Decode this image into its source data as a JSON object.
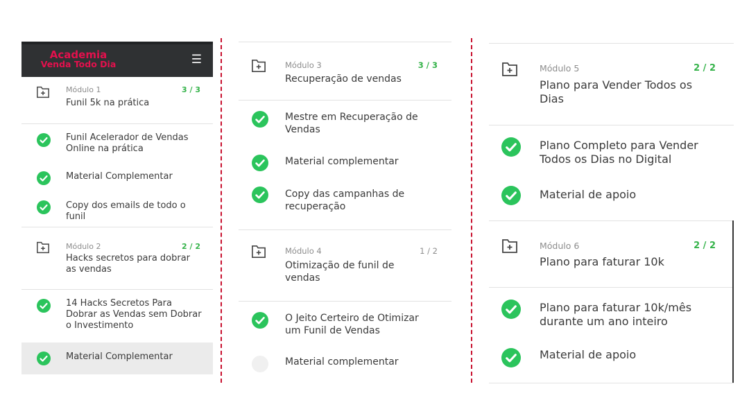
{
  "header": {
    "logo_line1": "Academia",
    "logo_line2": "Venda Todo Dia",
    "menu_icon": "hamburger-menu-icon"
  },
  "colors": {
    "brand": "#e4104d",
    "header_bg": "#2f3133",
    "check": "#2bc45c",
    "count_done": "#35b34a",
    "divider": "#c8102e"
  },
  "panel1": {
    "m1": {
      "label": "Módulo 1",
      "count": "3 / 3",
      "title": "Funil 5k na prática"
    },
    "m1_lessons": [
      "Funil Acelerador de Vendas Online na prática",
      "Material Complementar",
      "Copy dos emails de todo o funil"
    ],
    "m2": {
      "label": "Módulo 2",
      "count": "2 / 2",
      "title": "Hacks secretos para dobrar as vendas"
    },
    "m2_lessons": [
      "14 Hacks Secretos Para Dobrar as Vendas sem Dobrar o Investimento",
      "Material Complementar"
    ]
  },
  "panel2": {
    "m3": {
      "label": "Módulo 3",
      "count": "3 / 3",
      "title": "Recuperação de vendas"
    },
    "m3_lessons": [
      "Mestre em Recuperação de Vendas",
      "Material complementar",
      "Copy das campanhas de recuperação"
    ],
    "m4": {
      "label": "Módulo 4",
      "count": "1 / 2",
      "title": "Otimização de funil de vendas"
    },
    "m4_lessons": [
      "O Jeito Certeiro de Otimizar um Funil de Vendas",
      "Material complementar"
    ]
  },
  "panel3": {
    "m5": {
      "label": "Módulo 5",
      "count": "2 / 2",
      "title": "Plano para Vender Todos os Dias"
    },
    "m5_lessons": [
      "Plano Completo para Vender Todos os Dias no Digital",
      "Material de apoio"
    ],
    "m6": {
      "label": "Módulo 6",
      "count": "2 / 2",
      "title": "Plano para faturar 10k"
    },
    "m6_lessons": [
      "Plano para faturar 10k/mês durante um ano inteiro",
      "Material de apoio"
    ]
  }
}
